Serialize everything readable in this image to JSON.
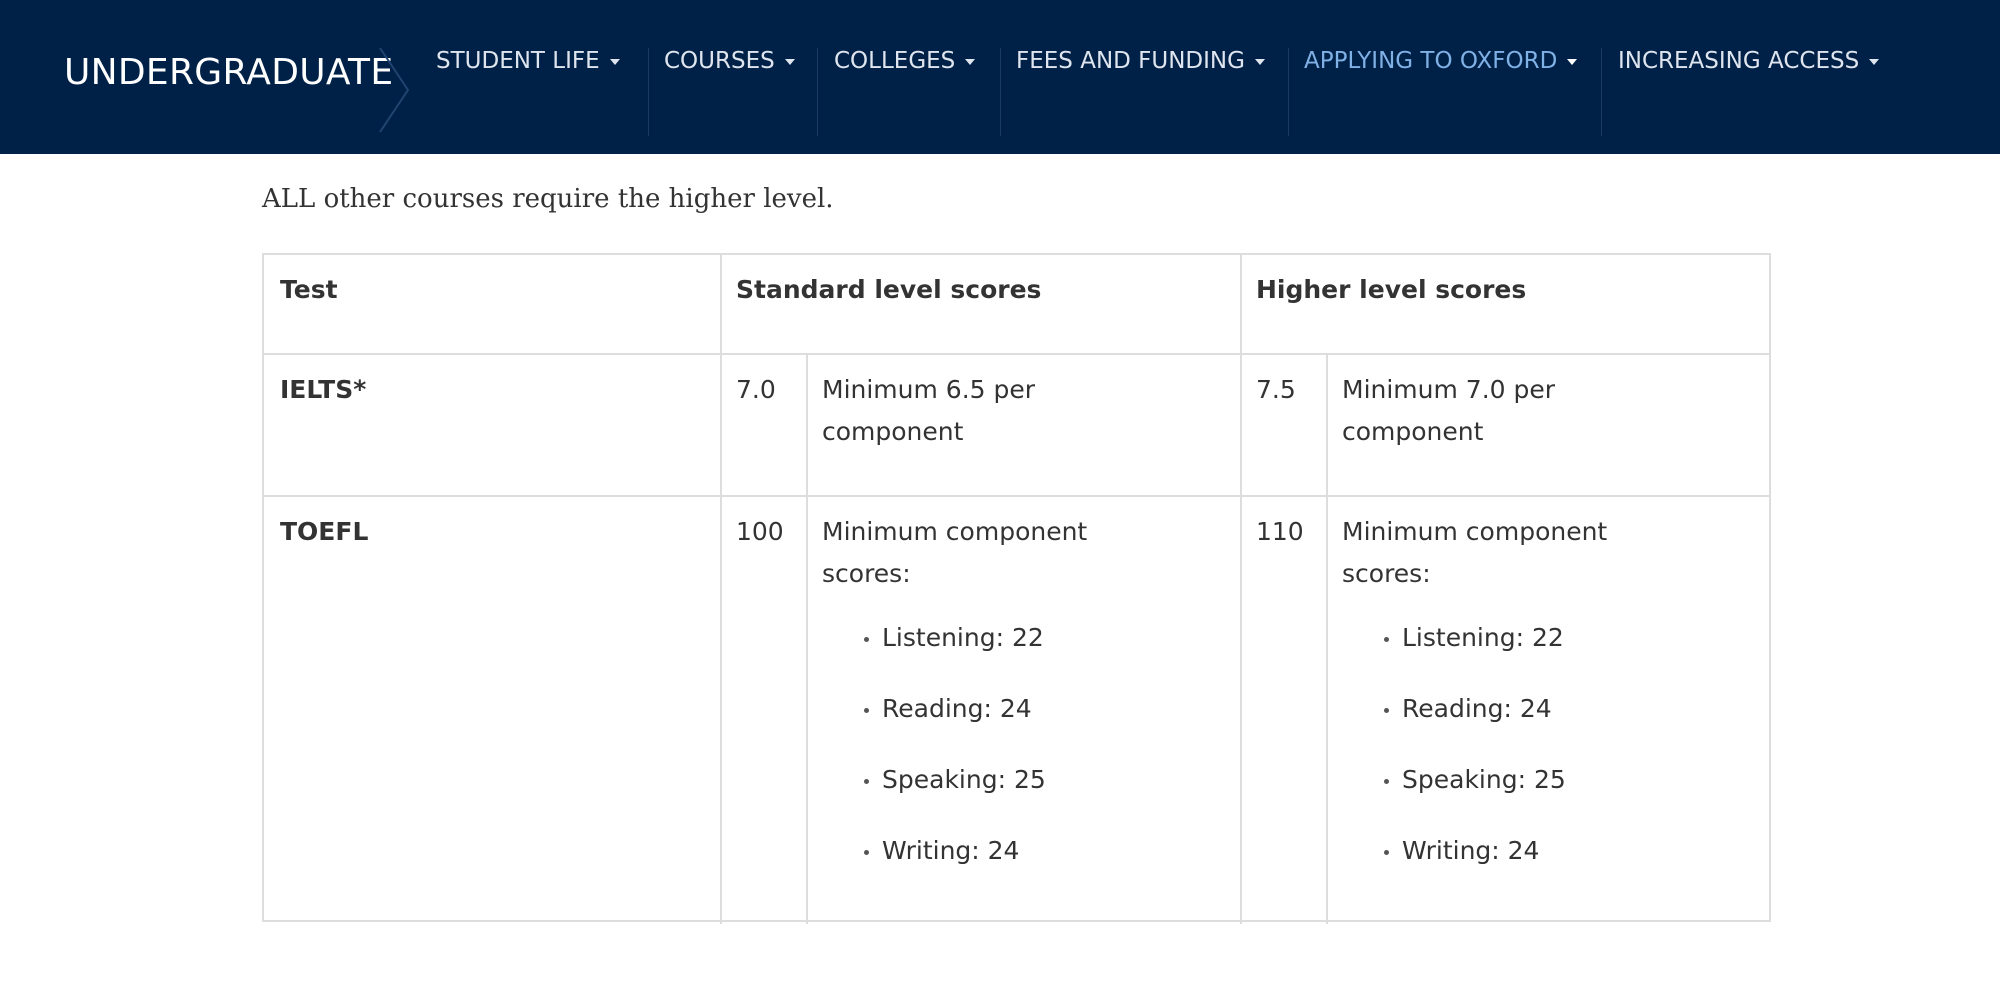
{
  "header": {
    "brand": "UNDERGRADUATE",
    "nav": [
      {
        "label": "STUDENT LIFE"
      },
      {
        "label": "COURSES"
      },
      {
        "label": "COLLEGES"
      },
      {
        "label": "FEES AND FUNDING"
      },
      {
        "label": "APPLYING TO OXFORD",
        "active": true
      },
      {
        "label": "INCREASING ACCESS"
      }
    ]
  },
  "main": {
    "intro": "ALL other courses require the higher level."
  },
  "table": {
    "headers": [
      "Test",
      "Standard level scores",
      "Higher level scores"
    ],
    "rows": [
      {
        "test": "IELTS*",
        "standard_score": "7.0",
        "standard_detail": [
          "Minimum 6.5 per",
          "component"
        ],
        "higher_score": "7.5",
        "higher_detail": [
          "Minimum 7.0 per",
          "component"
        ]
      },
      {
        "test": "TOEFL",
        "standard_score": "100",
        "standard_detail": [
          "Minimum component",
          "scores:"
        ],
        "standard_list": [
          "Listening: 22",
          "Reading: 24",
          "Speaking: 25",
          "Writing: 24"
        ],
        "higher_score": "110",
        "higher_detail": [
          "Minimum component",
          "scores:"
        ],
        "higher_list": [
          "Listening: 22",
          "Reading: 24",
          "Speaking: 25",
          "Writing: 24"
        ]
      }
    ]
  },
  "colors": {
    "nav_background": "#002147",
    "nav_text": "#dfe5ee",
    "nav_active": "#7fb0e6",
    "border": "#dddddd",
    "body_text": "#333333"
  }
}
